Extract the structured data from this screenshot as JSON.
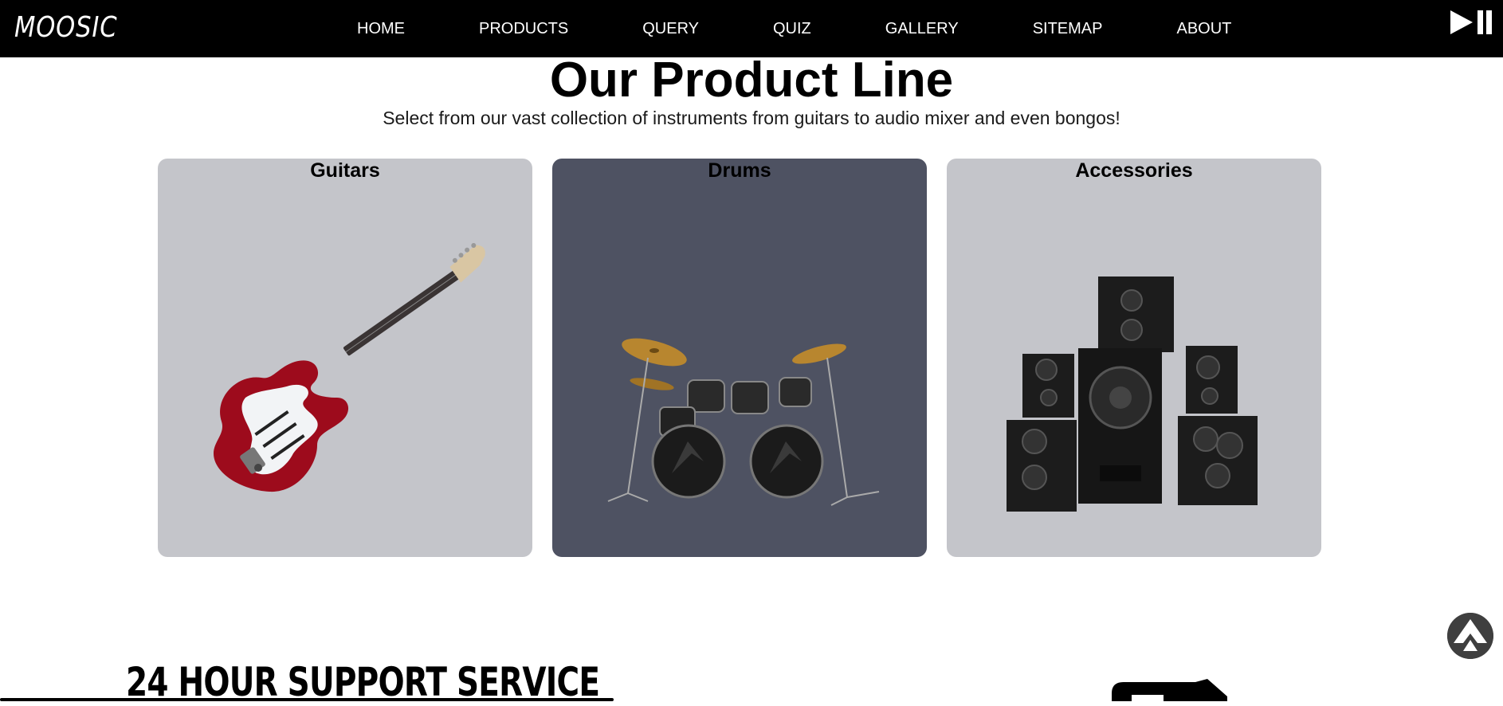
{
  "nav": {
    "logo": "MOOSIC",
    "links": [
      "HOME",
      "PRODUCTS",
      "QUERY",
      "QUIZ",
      "GALLERY",
      "SITEMAP",
      "ABOUT"
    ]
  },
  "icons": {
    "play_pause": "play-pause-icon",
    "scroll_top": "arrow-up-icon"
  },
  "main": {
    "title": "Our Product Line",
    "subtitle": "Select from our vast collection of instruments from guitars to audio mixer and even bongos!",
    "cards": [
      {
        "title": "Guitars",
        "image": "electric-guitar-image",
        "bg": "#c4c5ca"
      },
      {
        "title": "Drums",
        "image": "drum-kit-image",
        "bg": "#4e5262"
      },
      {
        "title": "Accessories",
        "image": "speakers-image",
        "bg": "#c4c5ca"
      }
    ]
  },
  "support": {
    "title": "24 HOUR SUPPORT SERVICE"
  },
  "colors": {
    "navbar": "#000000",
    "text": "#000000",
    "card_light": "#c4c5ca",
    "card_dark": "#4e5262"
  }
}
